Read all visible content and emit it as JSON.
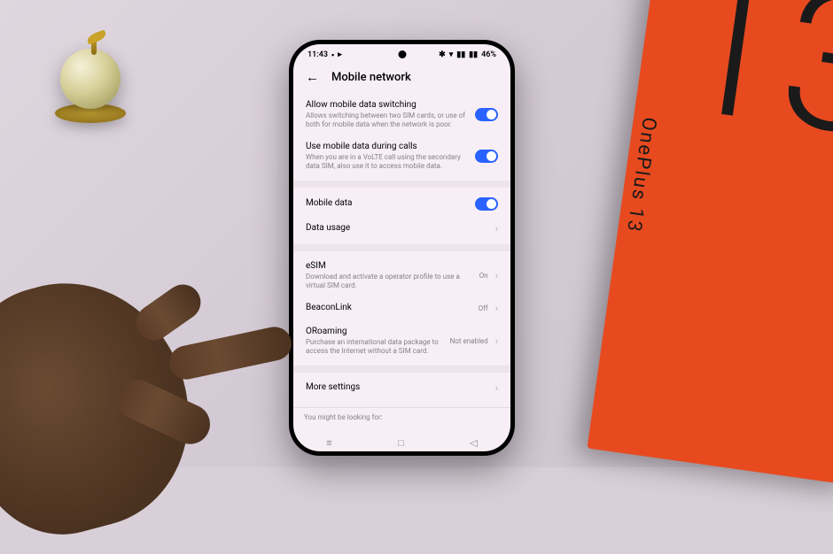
{
  "status": {
    "time": "11:43",
    "battery": "46%"
  },
  "header": {
    "title": "Mobile network"
  },
  "items": {
    "switching": {
      "title": "Allow mobile data switching",
      "sub": "Allows switching between two SIM cards, or use of both for mobile data when the network is poor."
    },
    "during_calls": {
      "title": "Use mobile data during calls",
      "sub": "When you are in a VoLTE call using the secondary data SIM, also use it to access mobile data."
    },
    "mobile_data": {
      "title": "Mobile data"
    },
    "data_usage": {
      "title": "Data usage"
    },
    "esim": {
      "title": "eSIM",
      "sub": "Download and activate a operator profile to use a virtual SIM card.",
      "value": "On"
    },
    "beaconlink": {
      "title": "BeaconLink",
      "value": "Off"
    },
    "oroaming": {
      "title": "ORoaming",
      "sub": "Purchase an international data package to access the Internet without a SIM card.",
      "value": "Not enabled"
    },
    "more": {
      "title": "More settings"
    }
  },
  "footer_hint": "You might be looking for:",
  "box": {
    "brand": "OnePlus 13",
    "number": "13"
  }
}
